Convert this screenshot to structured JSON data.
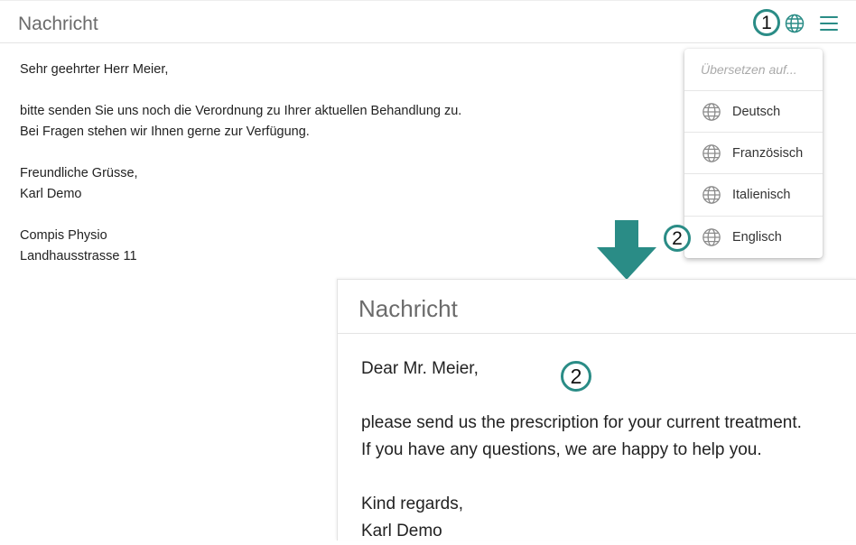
{
  "top_panel": {
    "title": "Nachricht",
    "message_lines": [
      "Sehr geehrter Herr Meier,",
      "",
      "bitte senden Sie uns noch die Verordnung zu Ihrer aktuellen Behandlung zu.",
      "Bei Fragen stehen wir Ihnen gerne zur Verfügung.",
      "",
      "Freundliche Grüsse,",
      "Karl Demo",
      "",
      "Compis Physio",
      "Landhausstrasse 11"
    ]
  },
  "dropdown": {
    "placeholder": "Übersetzen auf...",
    "items": [
      {
        "label": "Deutsch",
        "icon": "globe-icon"
      },
      {
        "label": "Französisch",
        "icon": "globe-icon"
      },
      {
        "label": "Italienisch",
        "icon": "globe-icon"
      },
      {
        "label": "Englisch",
        "icon": "globe-icon"
      }
    ]
  },
  "markers": {
    "step1": "1",
    "step2_menu": "2",
    "step2_result": "2"
  },
  "bottom_panel": {
    "title": "Nachricht",
    "message_lines": [
      "Dear Mr. Meier,",
      "",
      "please send us the prescription for your current treatment.",
      "If you have any questions, we are happy to help you.",
      "",
      "Kind regards,",
      "Karl Demo"
    ]
  },
  "colors": {
    "accent": "#2a8c86",
    "arrow": "#2a8c86",
    "icon_gray": "#8a8a8a"
  }
}
